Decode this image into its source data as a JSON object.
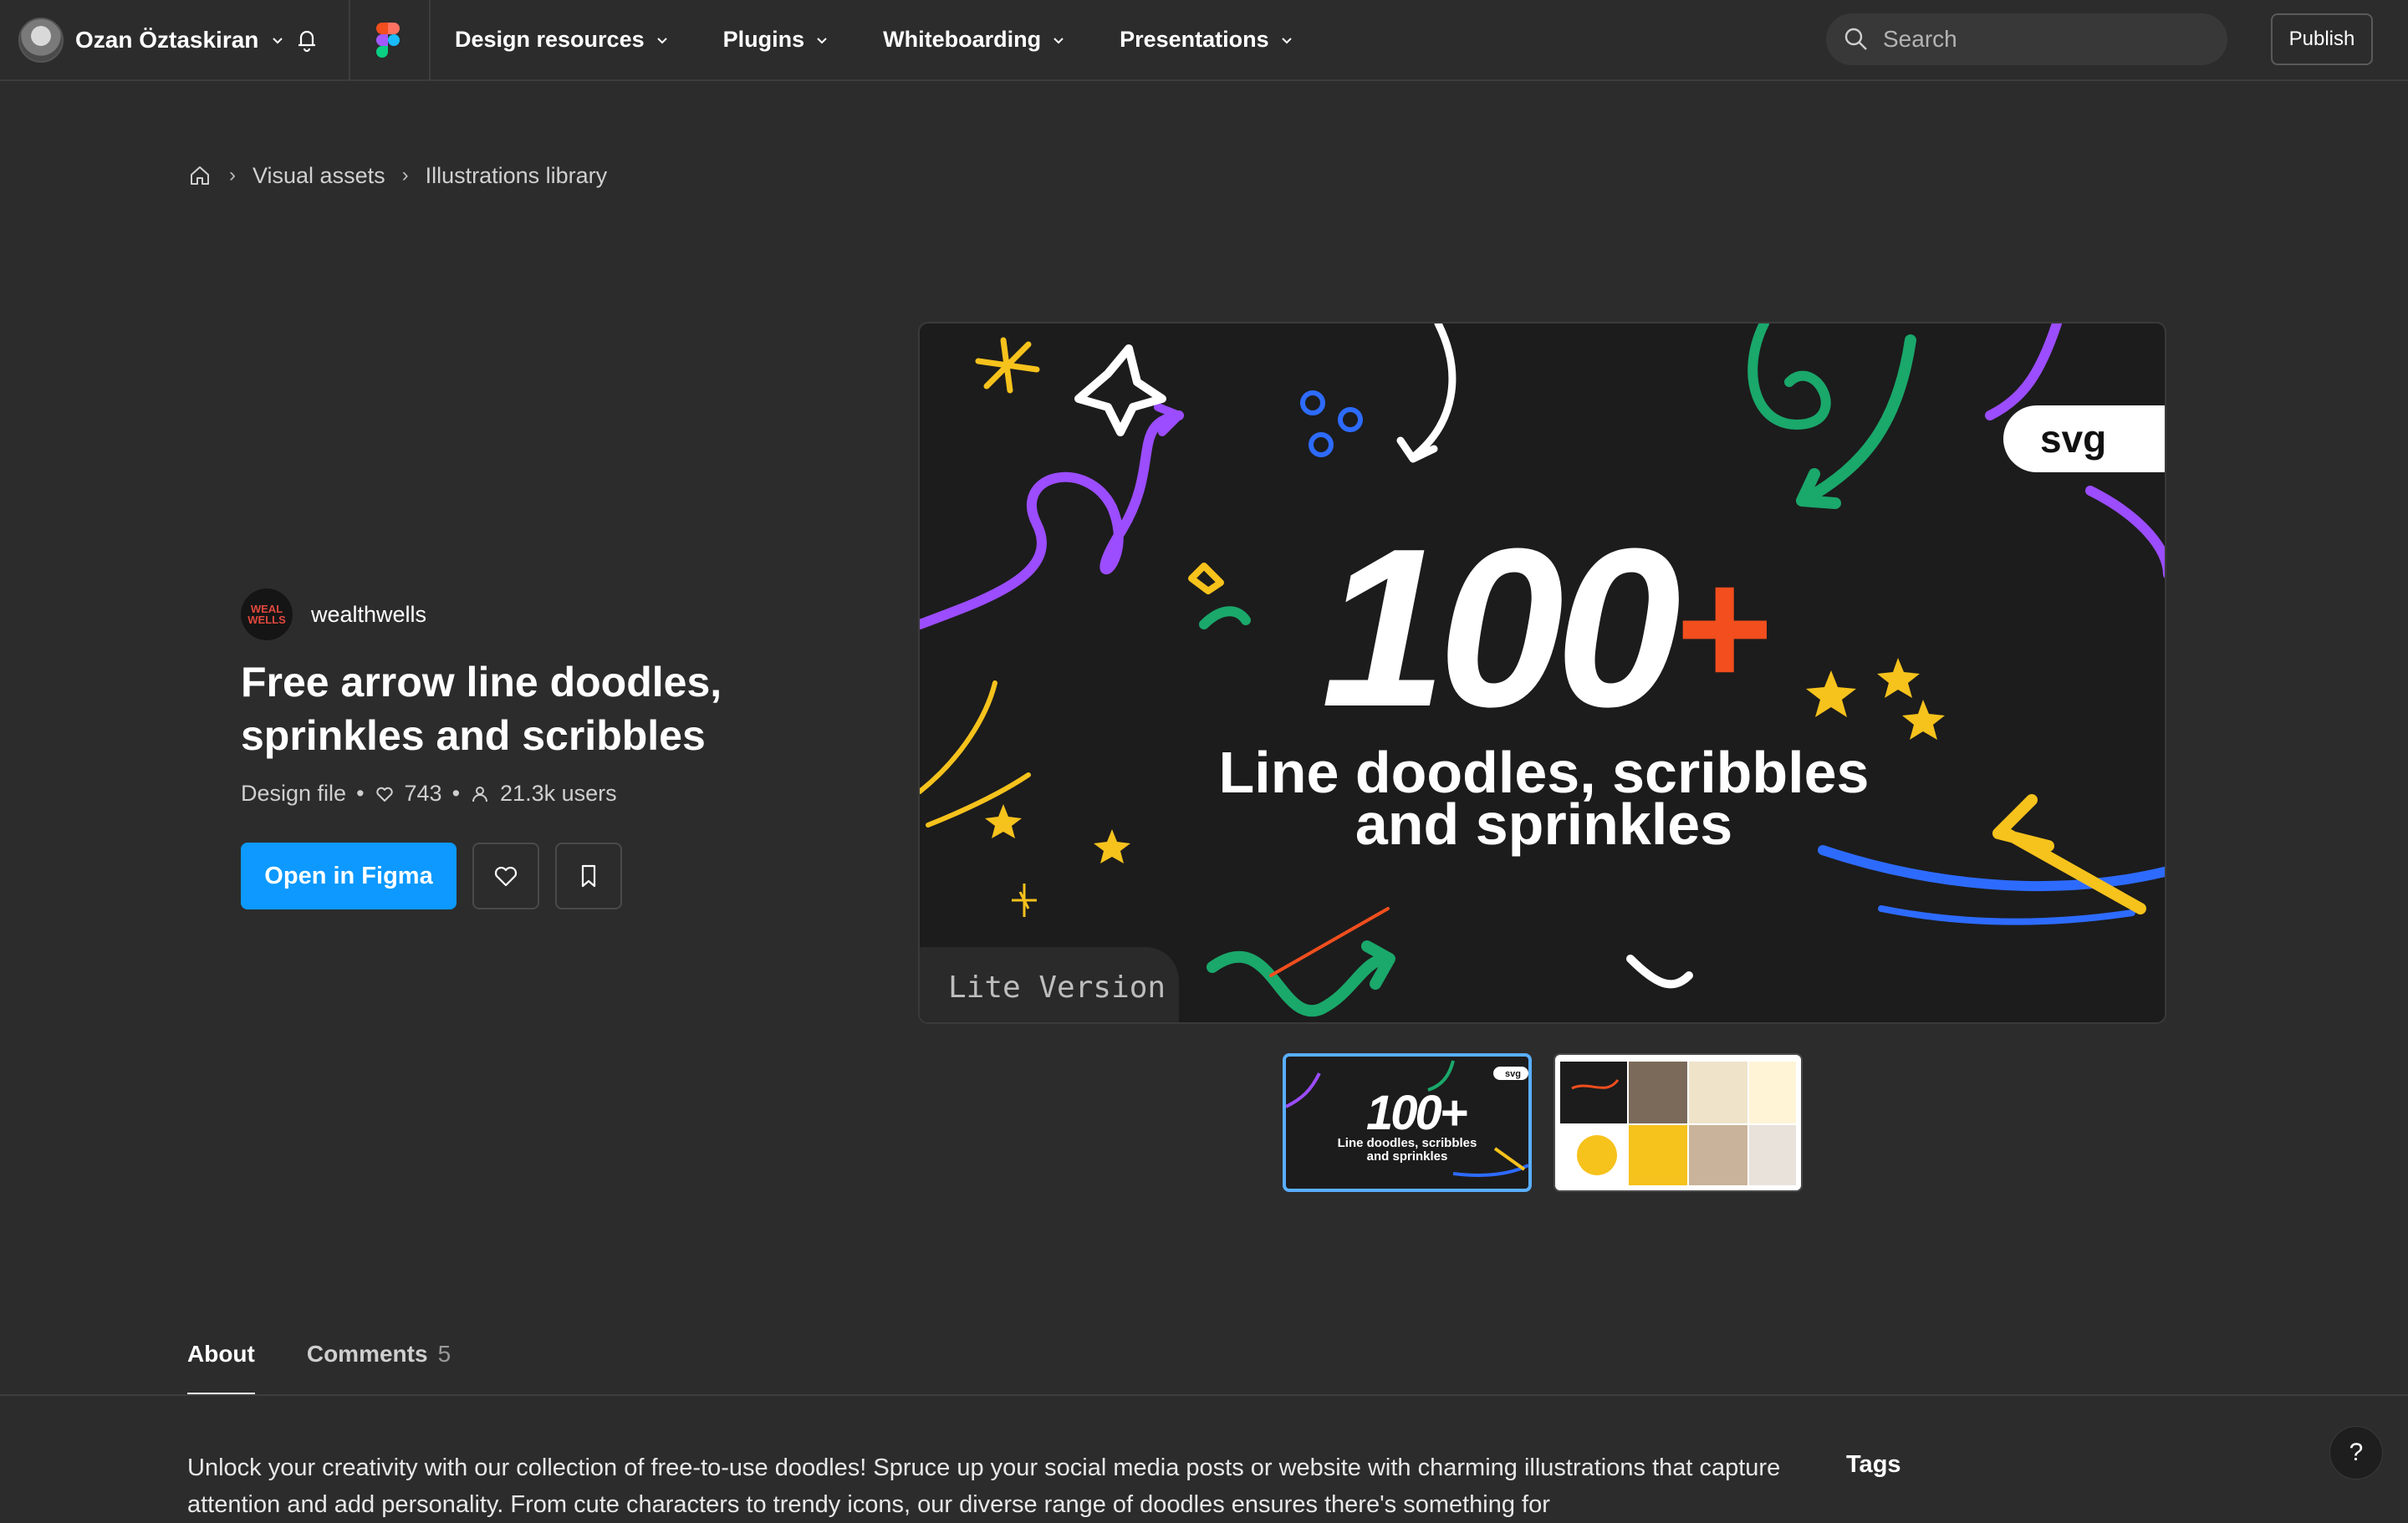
{
  "user": {
    "name": "Ozan Öztaskiran",
    "avatar_icon": "user-avatar"
  },
  "nav": {
    "items": [
      {
        "label": "Design resources"
      },
      {
        "label": "Plugins"
      },
      {
        "label": "Whiteboarding"
      },
      {
        "label": "Presentations"
      }
    ]
  },
  "search": {
    "placeholder": "Search"
  },
  "publish_label": "Publish",
  "breadcrumb": {
    "home_icon": "home-icon",
    "items": [
      "Visual assets",
      "Illustrations library"
    ]
  },
  "resource": {
    "author": "wealthwells",
    "author_logo_text": "WEAL WELLS",
    "title": "Free arrow line doodles, sprinkles and scribbles",
    "type": "Design file",
    "likes": "743",
    "users": "21.3k users",
    "open_label": "Open in Figma"
  },
  "preview": {
    "big_number": "100+",
    "line1": "Line doodles, scribbles",
    "line2": "and sprinkles",
    "badge": "svg",
    "version": "Lite Version"
  },
  "thumbnails": [
    {
      "big": "100+",
      "caption1": "Line doodles, scribbles",
      "caption2": "and sprinkles"
    },
    {
      "label": "gallery"
    }
  ],
  "tabs": [
    {
      "label": "About"
    },
    {
      "label": "Comments",
      "count": "5"
    }
  ],
  "about_text": "Unlock your creativity with our collection of free-to-use doodles! Spruce up your social media posts or website with charming illustrations that capture attention and add personality. From cute characters to trendy icons, our diverse range of doodles ensures there's something for",
  "tags_heading": "Tags",
  "help_label": "?",
  "colors": {
    "accent": "#0d99ff",
    "background": "#2c2c2c",
    "doodle_purple": "#9b4dff",
    "doodle_green": "#1aa86b",
    "doodle_yellow": "#f6c21c",
    "doodle_red": "#f24e1e",
    "doodle_blue": "#2d6bff"
  }
}
